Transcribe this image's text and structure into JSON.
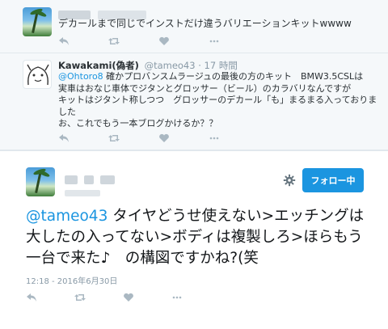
{
  "tweet1": {
    "text": "デカールまで同じでインストだけ違うバリエーションキットwwww"
  },
  "tweet2": {
    "author_name": "Kawakami(偽者)",
    "handle": "@tameo43",
    "separator": "·",
    "time": "17 時間",
    "reply_to": "@Ohtoro8",
    "lines": [
      " 確かプロバンスムラージュの最後の方のキット　BMW3.5CSLは",
      "実車はおなじ車体でジタンとグロッサー（ビール）のカラバリなんですが",
      "キットはジタント称しつつ　グロッサーのデカール「も」まるまる入っておりま",
      "した",
      "お、これでもう一本ブログかけるか？？"
    ]
  },
  "main": {
    "follow_label": "フォロー中",
    "mention": "@tameo43",
    "text": " タイヤどうせ使えない>エッチングは大したの入ってない>ボディは複製しろ>ほらもう一台で来た♪　の構図ですかね?(笑",
    "timestamp": "12:18 - 2016年6月30日"
  },
  "icons": {
    "reply": "reply-icon",
    "retweet": "retweet-icon",
    "like": "heart-icon",
    "more": "more-icon",
    "settings": "gear-icon"
  },
  "colors": {
    "link": "#1b95e0",
    "follow_button": "#1b95e0",
    "icon_grey": "#aab8c2"
  }
}
